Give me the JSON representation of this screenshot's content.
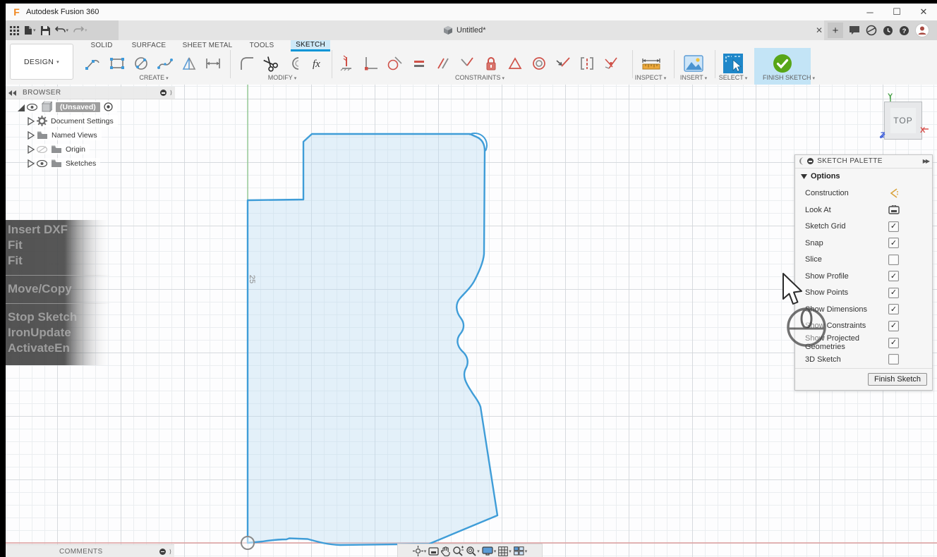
{
  "window": {
    "title": "Autodesk Fusion 360",
    "controls": [
      "minimize-icon",
      "maximize-icon",
      "close-icon"
    ]
  },
  "tabstrip": {
    "quick_access_icons": [
      "app-grid-icon",
      "new-file-icon",
      "save-icon",
      "undo-icon",
      "redo-icon"
    ],
    "document_tab": "Untitled*",
    "right_icons": [
      "close-tab-icon",
      "new-tab-icon",
      "comments-bubble-icon",
      "extensions-icon",
      "notifications-icon",
      "help-icon",
      "avatar"
    ]
  },
  "ribbon": {
    "workspace": "DESIGN",
    "tabs": [
      "SOLID",
      "SURFACE",
      "SHEET METAL",
      "TOOLS",
      "SKETCH"
    ],
    "active_tab": "SKETCH",
    "groups": {
      "create": "CREATE",
      "modify": "MODIFY",
      "constraints": "CONSTRAINTS",
      "inspect": "INSPECT",
      "insert": "INSERT",
      "select": "SELECT",
      "finish": "FINISH SKETCH"
    },
    "create_icons": [
      "line-icon",
      "rectangle-icon",
      "circle-icon",
      "spline-icon",
      "mirror-icon",
      "dimension-icon"
    ],
    "modify_icons": [
      "fillet-icon",
      "trim-icon",
      "offset-icon",
      "fx-icon"
    ],
    "constraint_icons": [
      "horizontal-vertical-icon",
      "coincident-icon",
      "tangent-icon",
      "equal-icon",
      "parallel-icon",
      "perpendicular-icon",
      "fix-icon",
      "midpoint-icon",
      "concentric-icon",
      "collinear-icon",
      "symmetry-icon",
      "curvature-icon"
    ]
  },
  "browser": {
    "title": "BROWSER",
    "root_label": "(Unsaved)",
    "items": [
      {
        "label": "Document Settings",
        "icon": "gear-icon"
      },
      {
        "label": "Named Views",
        "icon": "folder-icon"
      },
      {
        "label": "Origin",
        "icon": "folder-icon",
        "visibility": "hidden"
      },
      {
        "label": "Sketches",
        "icon": "folder-icon",
        "visibility": "visible"
      }
    ]
  },
  "overlay_commands": {
    "groups": [
      [
        "Insert DXF",
        "Fit",
        "Fit"
      ],
      [
        "Move/Copy"
      ],
      [
        "Stop Sketch",
        "IronUpdate",
        "ActivateEn"
      ]
    ]
  },
  "viewcube": {
    "face": "TOP",
    "axis_y": "Y",
    "axis_x": "X",
    "axis_z": "Z"
  },
  "canvas": {
    "dimension_label": "25"
  },
  "sketch_palette": {
    "title": "SKETCH PALETTE",
    "section": "Options",
    "rows": [
      {
        "label": "Construction",
        "control": "construction-icon"
      },
      {
        "label": "Look At",
        "control": "look-at-icon"
      },
      {
        "label": "Sketch Grid",
        "checked": true
      },
      {
        "label": "Snap",
        "checked": true
      },
      {
        "label": "Slice",
        "checked": false
      },
      {
        "label": "Show Profile",
        "checked": true
      },
      {
        "label": "Show Points",
        "checked": true
      },
      {
        "label": "Show Dimensions",
        "checked": true
      },
      {
        "label": "Show Constraints",
        "checked": true
      },
      {
        "label": "Show Projected Geometries",
        "checked": true
      },
      {
        "label": "3D Sketch",
        "checked": false
      }
    ],
    "finish_button": "Finish Sketch"
  },
  "statusbar": {
    "comments_label": "COMMENTS",
    "nav_icons": [
      "orbit-icon",
      "look-at-icon",
      "pan-icon",
      "zoom-icon",
      "zoom-window-icon",
      "display-settings-icon",
      "grid-settings-icon",
      "viewports-icon"
    ]
  },
  "colors": {
    "accent_blue": "#0696d7",
    "sketch_stroke": "#3f9dd8",
    "sketch_fill": "#dcedf8",
    "axis_x_red": "#de9e9e",
    "axis_y_green": "#86c586",
    "finish_green": "#58a618"
  }
}
